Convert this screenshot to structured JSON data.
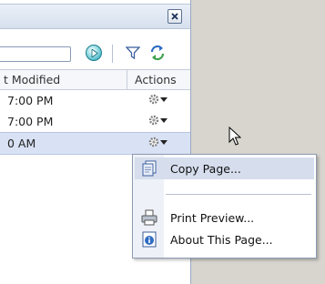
{
  "table": {
    "columns": {
      "modified": "t Modified",
      "actions": "Actions"
    },
    "rows": [
      {
        "modified": "7:00 PM"
      },
      {
        "modified": "7:00 PM"
      },
      {
        "modified": "0 AM"
      }
    ],
    "selected_row": 2
  },
  "toolbar": {
    "search_value": ""
  },
  "menu": {
    "items": [
      {
        "label": "Copy Page...",
        "icon": "copy-page-icon"
      },
      {
        "label": "Print Preview...",
        "icon": "printer-icon"
      },
      {
        "label": "About This Page...",
        "icon": "info-icon"
      }
    ],
    "highlighted_item": 0
  },
  "colors": {
    "background": "#d7d5ce",
    "header": "#d6e0ee",
    "selection": "#d9e2f5",
    "menu_highlight": "#d6deee"
  }
}
